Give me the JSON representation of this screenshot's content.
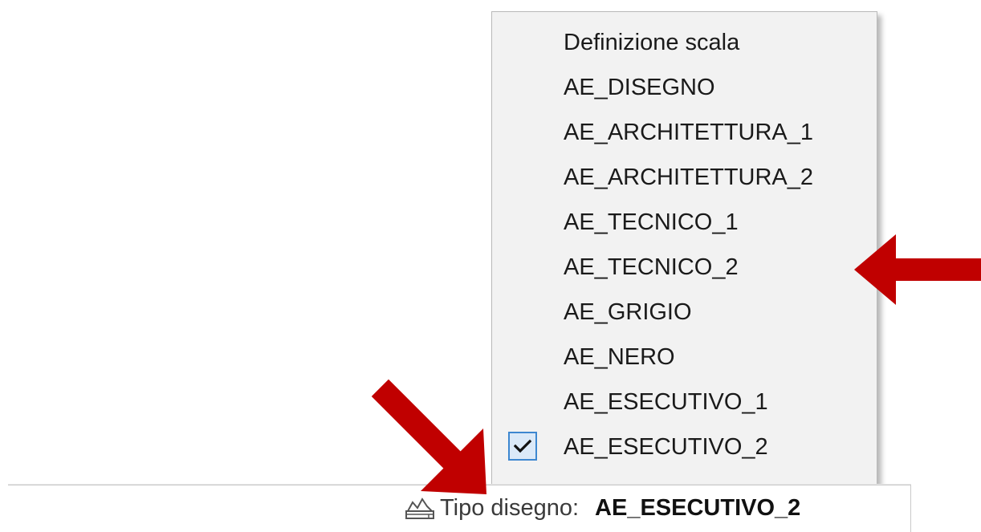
{
  "menu": {
    "items": [
      {
        "label": "Definizione scala",
        "checked": false
      },
      {
        "label": "AE_DISEGNO",
        "checked": false
      },
      {
        "label": "AE_ARCHITETTURA_1",
        "checked": false
      },
      {
        "label": "AE_ARCHITETTURA_2",
        "checked": false
      },
      {
        "label": "AE_TECNICO_1",
        "checked": false
      },
      {
        "label": "AE_TECNICO_2",
        "checked": false
      },
      {
        "label": "AE_GRIGIO",
        "checked": false
      },
      {
        "label": "AE_NERO",
        "checked": false
      },
      {
        "label": "AE_ESECUTIVO_1",
        "checked": false
      },
      {
        "label": "AE_ESECUTIVO_2",
        "checked": true
      }
    ]
  },
  "status_bar": {
    "drawing_type_label": "Tipo disegno:",
    "drawing_type_value": "AE_ESECUTIVO_2",
    "icon": "drawing-type-icon"
  },
  "colors": {
    "annotation_arrow": "#c00000",
    "check_accent": "#3d87d0",
    "menu_background": "#f2f2f2"
  }
}
